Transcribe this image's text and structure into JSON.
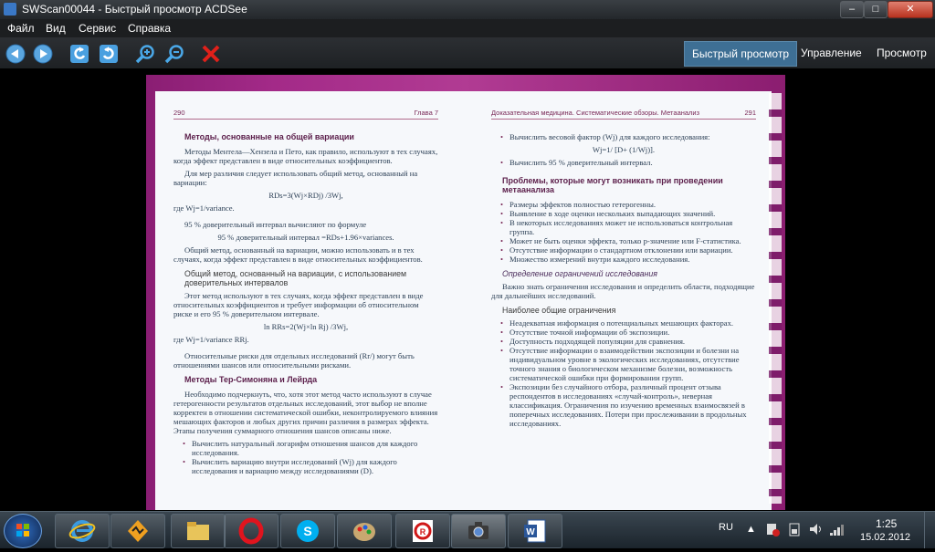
{
  "window": {
    "title": "SWScan00044 - Быстрый просмотр ACDSee"
  },
  "menu": [
    "Файл",
    "Вид",
    "Сервис",
    "Справка"
  ],
  "toolbar": {
    "icons": [
      "back-icon",
      "forward-icon",
      "rotate-left-icon",
      "rotate-right-icon",
      "zoom-in-icon",
      "zoom-out-icon",
      "delete-icon"
    ]
  },
  "modes": [
    "Быстрый просмотр",
    "Управление",
    "Просмотр"
  ],
  "document": {
    "left": {
      "page_num": "290",
      "chapter": "Глава 7",
      "h1": "Методы, основанные на общей вариации",
      "p1": "Методы Ментела—Хензела и Пето, как правило, используют в тех случаях, когда эффект представлен в виде относительных коэффициентов.",
      "p2": "Для мер различия следует использовать общий метод, основанный на вариации:",
      "f1": "RDs=3(Wj×RDj) /3Wj,",
      "p3": "где Wj=1/variance.",
      "p4": "95 % доверительный интервал вычисляют по формуле",
      "f2": "95 % доверительный интервал =RDs+1.96×variances.",
      "p5": "Общий метод, основанный на вариации, можно использовать и в тех случаях, когда эффект представлен в виде относительных коэффициентов.",
      "h2": "Общий метод, основанный на вариации, с использованием доверительных интервалов",
      "p6": "Этот метод используют в тех случаях, когда эффект представлен в виде относительных коэффициентов и требует информации об относительном риске и его 95 % доверительном интервале.",
      "f3": "ln RRs=2(Wj×ln Rj) /3Wj,",
      "p7": "где Wj=1/variance RRj.",
      "p8": "Относительные риски для отдельных исследований (Rr/) могут быть отношениями шансов или относительными рисками.",
      "h3": "Методы Тер-Симоняна и Лейрда",
      "p9": "Необходимо подчеркнуть, что, хотя этот метод часто используют в случае гетерогенности результатов отдельных исследований, этот выбор не вполне корректен в отношении систематической ошибки, неконтролируемого влияния мешающих факторов и любых других причин различия в размерах эффекта. Этапы получения суммарного отношения шансов описаны ниже.",
      "b1": "Вычислить натуральный логарифм отношения шансов для каждого исследования.",
      "b2": "Вычислить вариацию внутри исследований (Wj) для каждого исследования и вариацию между исследованиями (D)."
    },
    "right": {
      "header": "Доказательная медицина. Систематические обзоры. Метаанализ",
      "page_num": "291",
      "b1": "Вычислить весовой фактор (Wj) для каждого исследования:",
      "f1": "Wj=1/ [D+ (1/Wj)].",
      "b2": "Вычислить 95 % доверительный интервал.",
      "h1": "Проблемы, которые могут возникать при проведении метаанализа",
      "l1": [
        "Размеры эффектов полностью гетерогенны.",
        "Выявление в ходе оценки нескольких выпадающих значений.",
        "В некоторых исследованиях может не использоваться контрольная группа.",
        "Может не быть оценки эффекта, только р-значение или F-статистика.",
        "Отсутствие информации о стандартном отклонении или вариации.",
        "Множество измерений внутри каждого исследования."
      ],
      "h2": "Определение ограничений исследования",
      "p1": "Важно знать ограничения исследования и определить области, подходящие для дальнейших исследований.",
      "h3": "Наиболее общие ограничения",
      "l2": [
        "Неадекватная информация о потенциальных мешающих факторах.",
        "Отсутствие точной информации об экспозиции.",
        "Доступность подходящей популяции для сравнения.",
        "Отсутствие информации о взаимодействии экспозиции и болезни на индивидуальном уровне в экологических исследованиях, отсутствие точного знания о биологическом механизме болезни, возможность систематической ошибки при формировании групп.",
        "Экспозиции без случайного отбора, различный процент отзыва респондентов в исследованиях «случай-контроль», неверная классификация. Ограничения по изучению временных взаимосвязей в поперечных исследованиях. Потери при прослеживании в продольных исследованиях."
      ]
    }
  },
  "taskbar": {
    "apps": [
      "ie-icon",
      "winamp-icon",
      "explorer-icon",
      "opera-icon",
      "skype-icon",
      "paint-icon",
      "finereader-icon",
      "acdsee-icon",
      "word-icon"
    ],
    "lang": "RU",
    "time": "1:25",
    "date": "15.02.2012"
  },
  "colors": {
    "accent": "#3e6f94",
    "scan_magenta": "#a32a88"
  }
}
